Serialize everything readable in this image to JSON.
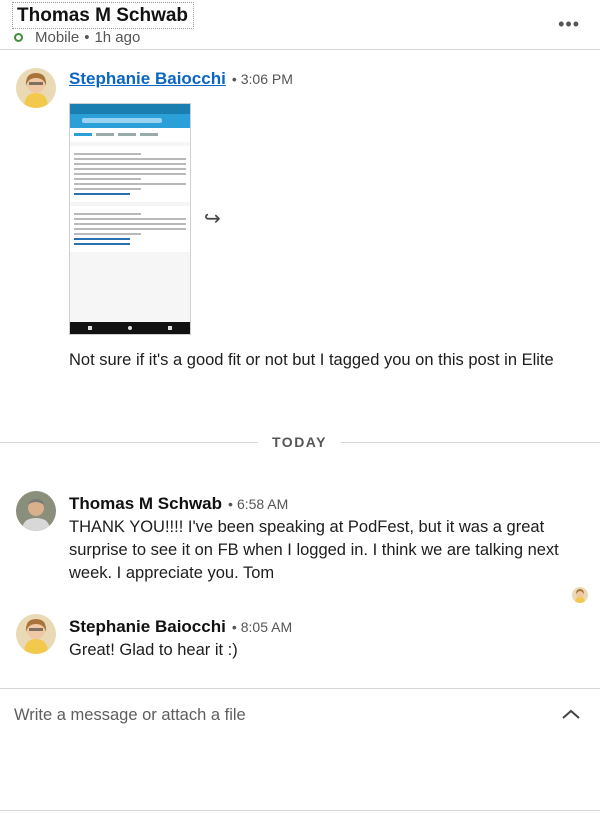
{
  "header": {
    "name": "Thomas M Schwab",
    "status": "Mobile",
    "last_seen": "1h ago",
    "more_icon": "more-horizontal-icon"
  },
  "messages": [
    {
      "sender": "Stephanie Baiocchi",
      "time": "3:06 PM",
      "attachment_icon": "share-forward-icon",
      "body": "Not sure if it's a good fit or not but I tagged you on this post in Elite"
    },
    {
      "sender": "Thomas M Schwab",
      "time": "6:58 AM",
      "body": "THANK YOU!!!!  I've been speaking at PodFest, but it was a great surprise to see it on FB when I logged in.  I think we are talking next week.  I appreciate you.  Tom"
    },
    {
      "sender": "Stephanie Baiocchi",
      "time": "8:05 AM",
      "body": "Great! Glad to hear it :)"
    }
  ],
  "divider": {
    "label": "TODAY"
  },
  "composer": {
    "placeholder": "Write a message or attach a file",
    "expand_icon": "chevron-up-icon"
  },
  "colors": {
    "accent": "#0a66c2",
    "presence": "#3e8f3e",
    "divider": "#d6d6d6"
  }
}
